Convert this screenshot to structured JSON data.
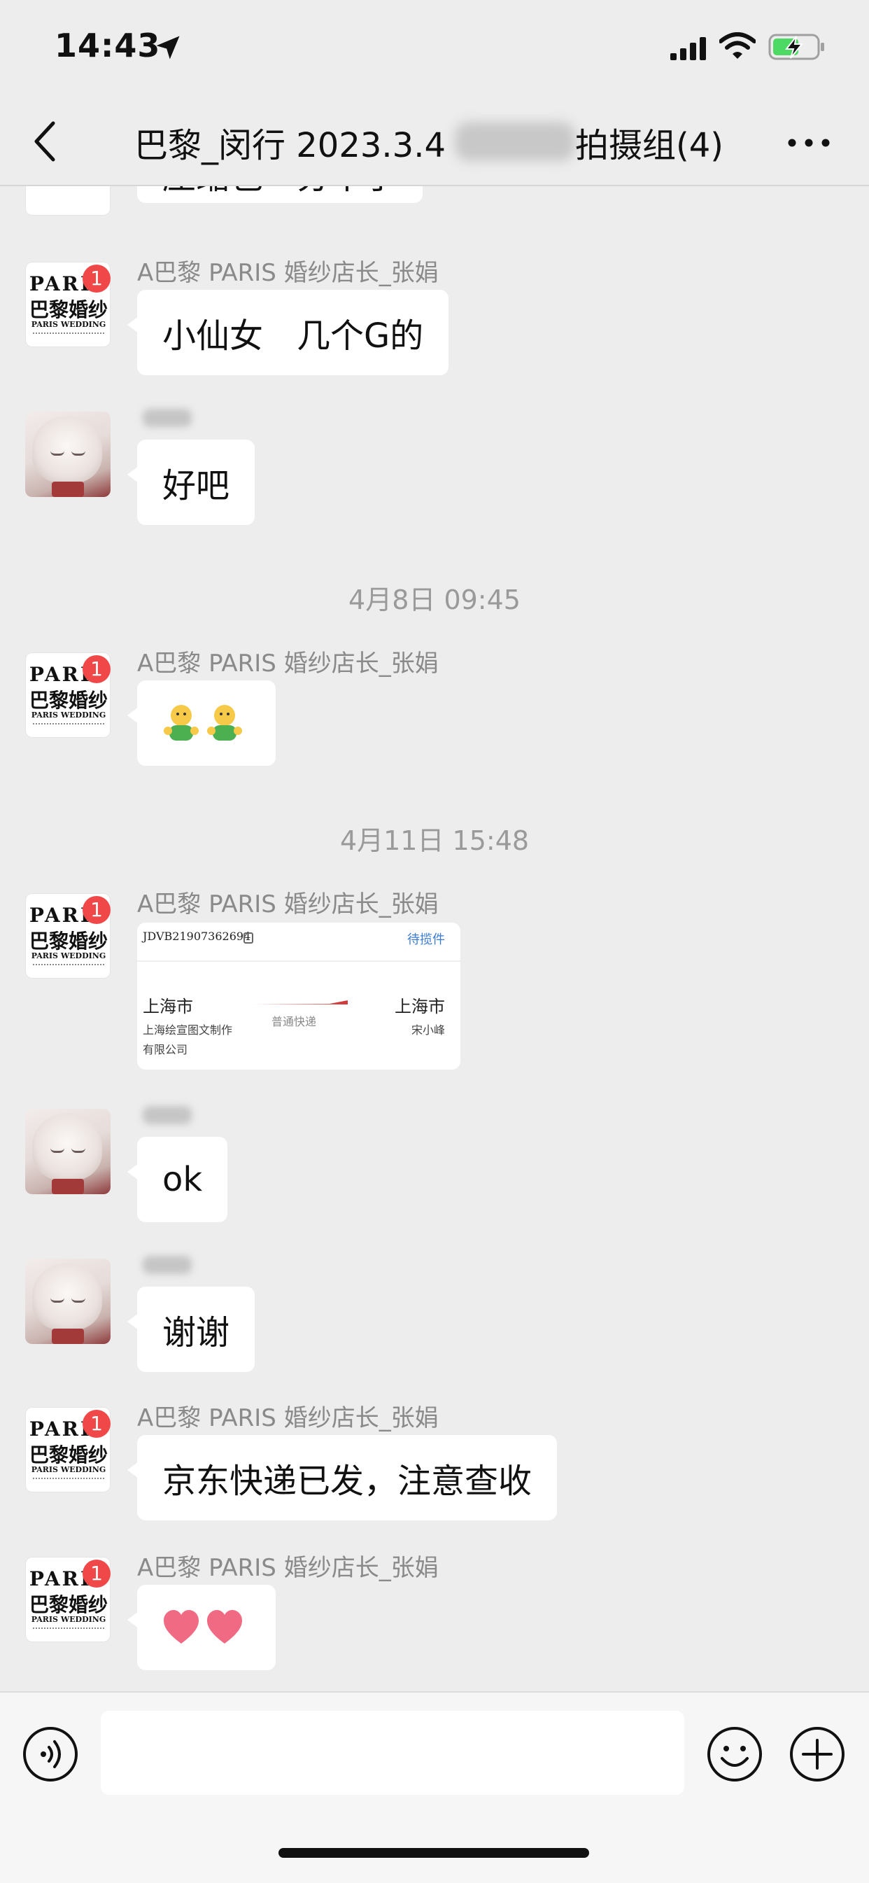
{
  "status_bar": {
    "time": "14:43",
    "icons": [
      "location-arrow-icon",
      "cellular-signal-icon",
      "wifi-icon",
      "battery-charging-icon"
    ]
  },
  "nav": {
    "back_icon": "chevron-left-icon",
    "title_prefix": "巴黎_闵行 2023.3.4",
    "title_suffix": "拍摄组(4)",
    "more_icon": "more-dots-icon"
  },
  "messages": [
    {
      "sender": "A巴黎 PARIS 婚纱店长_张娟",
      "text": "小仙女　几个G的"
    },
    {
      "sender": "",
      "text": "好吧"
    },
    {
      "timestamp": "4月8日 09:45"
    },
    {
      "sender": "A巴黎 PARIS 婚纱店长_张娟",
      "text": "🤗🤗",
      "kind": "emoji"
    },
    {
      "timestamp": "4月11日 15:48"
    },
    {
      "sender": "A巴黎 PARIS 婚纱店长_张娟",
      "kind": "shipping-card"
    },
    {
      "sender": "",
      "text": "ok"
    },
    {
      "sender": "",
      "text": "谢谢"
    },
    {
      "sender": "A巴黎 PARIS 婚纱店长_张娟",
      "text": "京东快递已发，注意查收"
    },
    {
      "sender": "A巴黎 PARIS 婚纱店长_张娟",
      "text": "❤❤",
      "kind": "emoji"
    }
  ],
  "partial_top_message": "压缩包　分不了",
  "shop_avatar": {
    "word": "PARIS",
    "cn": "巴黎婚纱",
    "sub": "PARIS WEDDING",
    "badge": "1"
  },
  "shipping_card": {
    "tracking_no": "JDVB21907362694",
    "status": "待揽件",
    "from_city": "上海市",
    "from_company": "上海绘宣图文制作有限公司",
    "from_company_line1": "上海绘宣图文制作",
    "from_company_line2": "有限公司",
    "service": "普通快递",
    "to_city": "上海市",
    "receiver": "宋小峰"
  },
  "input_bar": {
    "placeholder": "",
    "icons": [
      "voice-icon",
      "emoji-icon",
      "plus-icon"
    ]
  },
  "colors": {
    "background": "#ededed",
    "bubble": "#ffffff",
    "badge": "#f04848",
    "link": "#3a7bd5",
    "battery": "#4cd964"
  }
}
